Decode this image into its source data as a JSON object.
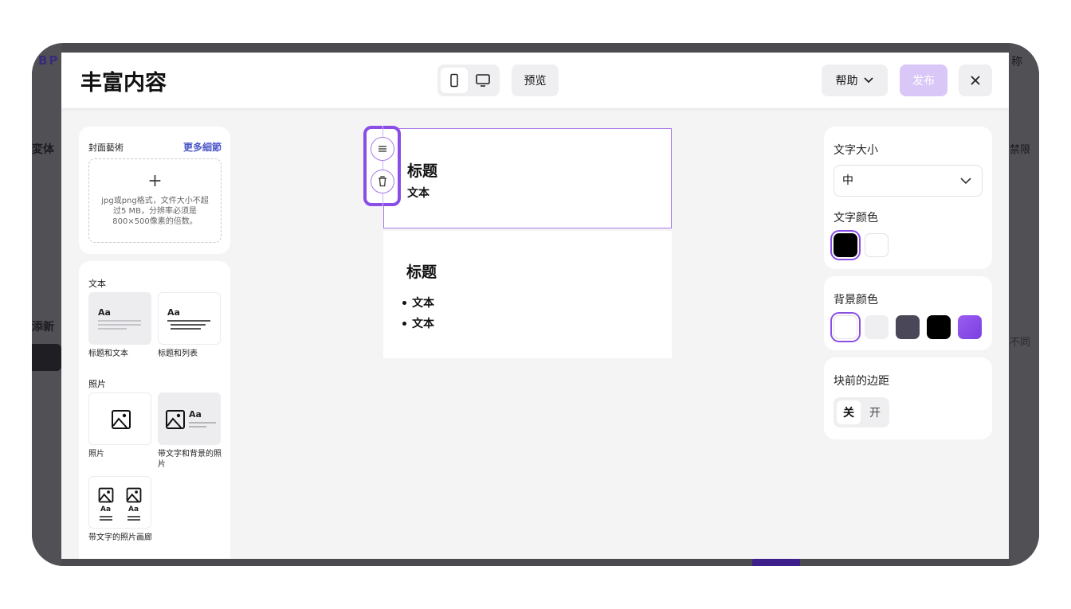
{
  "background_app": {
    "logo": "BP",
    "left_label_1": "変体",
    "left_label_2": "添新",
    "right_label_1": "称",
    "right_label_2": "禁限",
    "right_label_3": "不同"
  },
  "modal": {
    "title": "丰富内容",
    "preview_label": "预览",
    "help_label": "帮助",
    "publish_label": "发布"
  },
  "cover": {
    "label": "封面藝術",
    "more_link": "更多細節",
    "plus": "+",
    "hint": "jpg或png格式，文件大小不超过5 MB，分辨率必须是800×500像素的倍数。"
  },
  "blocks": {
    "text_section": "文本",
    "tile_title_text": "标题和文本",
    "tile_title_list": "标题和列表",
    "photo_section": "照片",
    "tile_photo": "照片",
    "tile_photo_bg": "带文字和背景的照片",
    "tile_gallery": "带文字的照片画廊",
    "aa": "Aa"
  },
  "canvas": {
    "block1_title": "标题",
    "block1_text": "文本",
    "block2_title": "标题",
    "block2_items": [
      "文本",
      "文本"
    ]
  },
  "settings": {
    "font_size_label": "文字大小",
    "font_size_value": "中",
    "text_color_label": "文字颜色",
    "text_colors": [
      "#000000",
      "#ffffff"
    ],
    "bg_color_label": "背景颜色",
    "bg_colors": [
      "#ffffff",
      "#efeff1",
      "#4a4858",
      "#000000",
      "#8a4ee6"
    ],
    "margin_label": "块前的边距",
    "margin_off": "关",
    "margin_on": "开"
  }
}
